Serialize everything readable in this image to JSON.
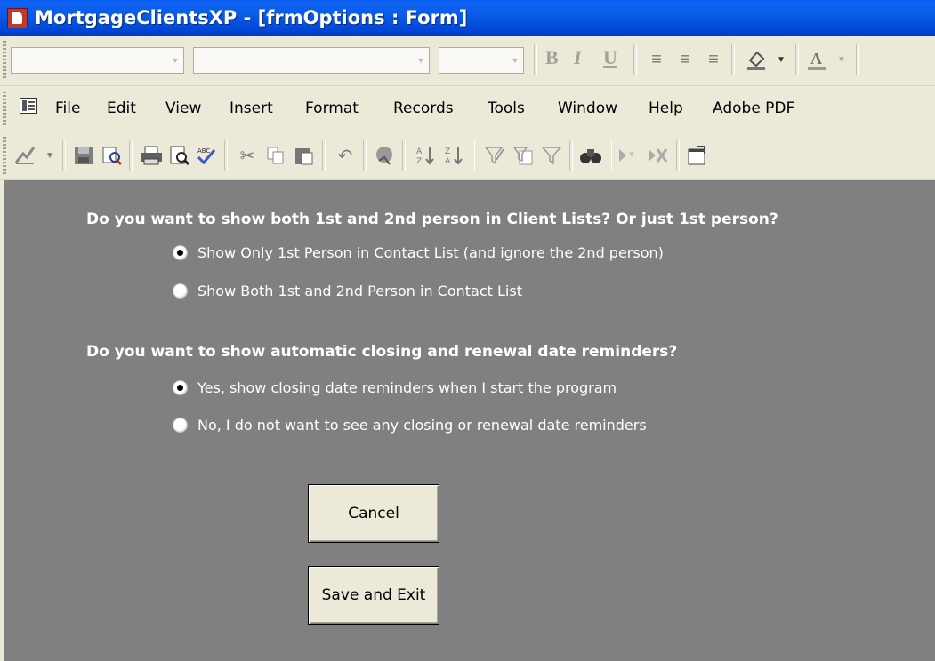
{
  "window": {
    "title": "MortgageClientsXP - [frmOptions : Form]"
  },
  "formatting_toolbar": {
    "bold_label": "B",
    "italic_label": "I",
    "underline_label": "U",
    "align_icons": [
      "align-left-icon",
      "align-center-icon",
      "align-right-icon"
    ],
    "fill_color_icon": "fill-color-icon",
    "font_color_icon": "font-color-icon"
  },
  "menu": {
    "icon": "form-view-icon",
    "items": [
      "File",
      "Edit",
      "View",
      "Insert",
      "Format",
      "Records",
      "Tools",
      "Window",
      "Help",
      "Adobe PDF"
    ]
  },
  "standard_toolbar": {
    "icons": [
      "view-icon",
      "save-icon",
      "file-search-icon",
      "print-icon",
      "print-preview-icon",
      "spelling-icon",
      "cut-icon",
      "copy-icon",
      "paste-icon",
      "undo-icon",
      "hyperlink-icon",
      "sort-ascending-icon",
      "sort-descending-icon",
      "filter-by-selection-icon",
      "filter-by-form-icon",
      "apply-filter-icon",
      "find-icon",
      "new-record-icon",
      "delete-record-icon",
      "properties-icon"
    ]
  },
  "form": {
    "question1": "Do you want to show both 1st and 2nd person in Client Lists?  Or just 1st person?",
    "q1_options": [
      {
        "label": "Show Only 1st Person in Contact List (and ignore the 2nd person)",
        "selected": true
      },
      {
        "label": "Show Both 1st and 2nd Person in Contact List",
        "selected": false
      }
    ],
    "question2": "Do you want to show automatic closing and renewal date reminders?",
    "q2_options": [
      {
        "label": "Yes, show closing date reminders when I start the program",
        "selected": true
      },
      {
        "label": "No, I do not want to see any closing or renewal date reminders",
        "selected": false
      }
    ],
    "cancel_label": "Cancel",
    "save_label": "Save and Exit"
  },
  "colors": {
    "form_bg": "#808080",
    "title_bar": "#0a5ae6",
    "chrome": "#ece9d8"
  }
}
